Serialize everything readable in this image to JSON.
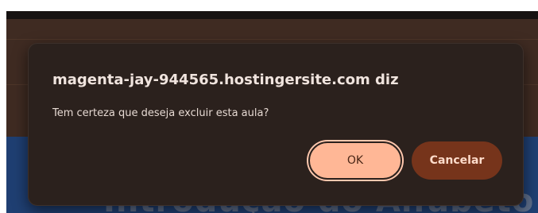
{
  "background_page": {
    "hero_title": "Introdução do Alfabeto M"
  },
  "dialog": {
    "title": "magenta-jay-944565.hostingersite.com diz",
    "message": "Tem certeza que deseja excluir esta aula?",
    "ok_label": "OK",
    "cancel_label": "Cancelar"
  },
  "colors": {
    "dialog_background": "#2b211d",
    "ok_button": "#ffb796",
    "cancel_button": "#76341b",
    "page_header": "#3f2b22",
    "page_hero": "#1f3f72"
  }
}
